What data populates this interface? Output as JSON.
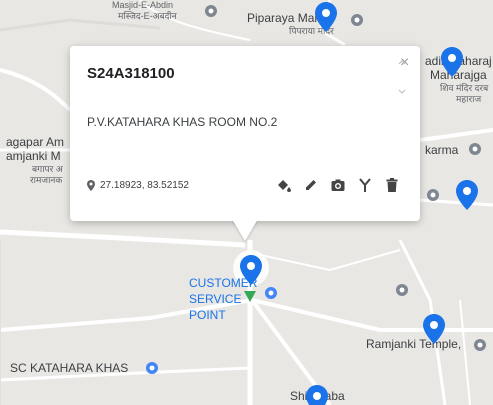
{
  "map_labels": {
    "masjid_top": "Masjid-E-Abdin",
    "masjid_hi": "मस्जिद-E-अबदीन",
    "piparaya": "Piparaya Mandir",
    "piparaya_hi": "पिपराया मंदिर",
    "right_top_1": "adir Maharaj",
    "right_top_2": "Maharajga",
    "right_top_hi": "शिव मंदिर दरब",
    "right_top_hi2": "महाराज",
    "left_1": "agapar Am",
    "left_2": "amjanki M",
    "left_hi_1": "बगापर अ",
    "left_hi_2": "रामजानक",
    "karma": "karma",
    "customer_service": "CUSTOMER SERVICE POINT",
    "ramjanki": "Ramjanki Temple,",
    "csc": "SC KATAHARA KHAS",
    "shiv_baba": "Shiv Baba"
  },
  "popup": {
    "title": "S24A318100",
    "address": "P.V.KATAHARA KHAS ROOM NO.2",
    "coords": "27.18923, 83.52152",
    "close_label": "×",
    "tools": [
      "paint-bucket-icon",
      "pencil-icon",
      "camera-icon",
      "fork-icon",
      "trash-icon"
    ]
  },
  "colors": {
    "pin_blue": "#1a73e8",
    "pin_green": "#34a853",
    "map_bg": "#e9e7e3",
    "road": "#ffffff"
  }
}
